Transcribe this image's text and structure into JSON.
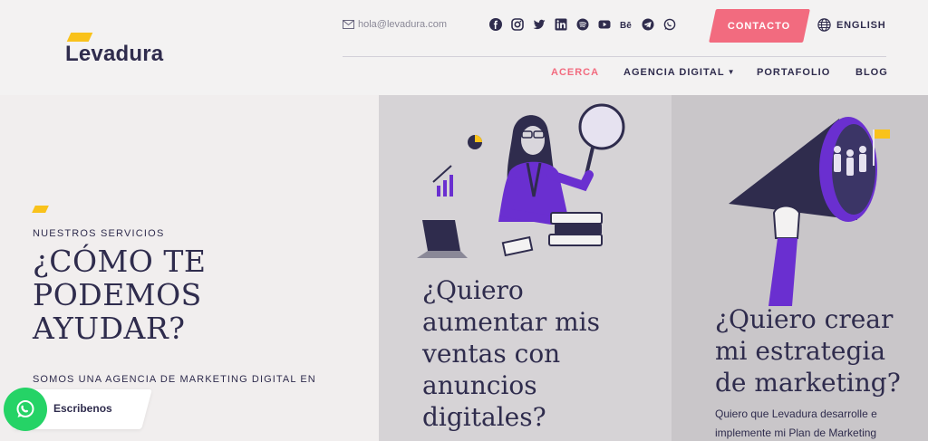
{
  "header": {
    "logo_text": "Levadura",
    "email": "hola@levadura.com",
    "socials": [
      "facebook-icon",
      "instagram-icon",
      "twitter-icon",
      "linkedin-icon",
      "spotify-icon",
      "youtube-icon",
      "behance-icon",
      "telegram-icon",
      "whatsapp-icon"
    ],
    "behance_label": "Bē",
    "contact_label": "CONTACTO",
    "language_label": "ENGLISH",
    "nav": {
      "about": "ACERCA",
      "agency": "AGENCIA DIGITAL",
      "portfolio": "PORTAFOLIO",
      "blog": "BLOG"
    }
  },
  "hero": {
    "eyebrow": "NUESTROS SERVICIOS",
    "title": "¿CÓMO TE PODEMOS AYUDAR?",
    "subtitle": "SOMOS UNA AGENCIA DE MARKETING DIGITAL EN"
  },
  "cards": [
    {
      "title": "¿Quiero aumentar mis ventas con anuncios digitales?"
    },
    {
      "title": "¿Quiero crear mi estrategia de marketing?",
      "text": "Quiero que Levadura desarrolle e implemente mi Plan de Marketing"
    }
  ],
  "chat": {
    "label": "Escribenos"
  },
  "colors": {
    "brand_dark": "#2f2c4d",
    "accent_pink": "#f26b7f",
    "accent_yellow": "#f9c21b",
    "illustration_purple": "#6a2fd0",
    "whatsapp_green": "#25d366"
  }
}
